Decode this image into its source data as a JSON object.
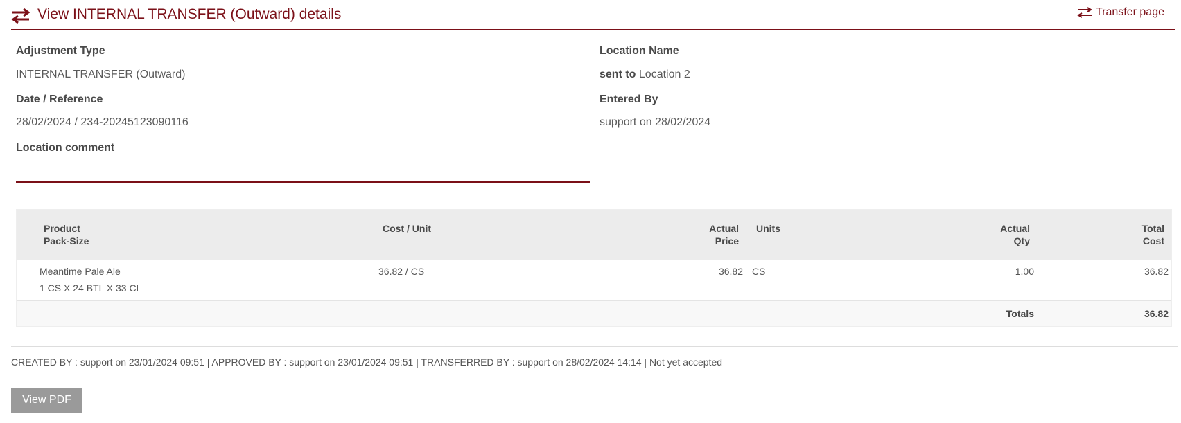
{
  "header": {
    "title": "View INTERNAL TRANSFER (Outward) details",
    "transfer_link": "Transfer page"
  },
  "details": {
    "adjustment_type_label": "Adjustment Type",
    "adjustment_type_value": "INTERNAL TRANSFER (Outward)",
    "date_reference_label": "Date / Reference",
    "date_reference_value": "28/02/2024 / 234-20245123090116",
    "location_comment_label": "Location comment",
    "location_name_label": "Location Name",
    "location_prefix": "sent to",
    "location_value": "Location 2",
    "entered_by_label": "Entered By",
    "entered_by_value": "support on 28/02/2024"
  },
  "table": {
    "headers": {
      "product": "Product",
      "pack_size": "Pack-Size",
      "cost_unit": "Cost / Unit",
      "actual_price_1": "Actual",
      "actual_price_2": "Price",
      "units": "Units",
      "actual_qty_1": "Actual",
      "actual_qty_2": "Qty",
      "total_cost_1": "Total",
      "total_cost_2": "Cost"
    },
    "rows": [
      {
        "product": "Meantime Pale Ale",
        "pack_size": "1 CS X 24 BTL X 33 CL",
        "cost_unit": "36.82 / CS",
        "actual_price": "36.82",
        "units": "CS",
        "actual_qty": "1.00",
        "total_cost": "36.82"
      }
    ],
    "totals_label": "Totals",
    "totals_value": "36.82"
  },
  "audit": "CREATED BY : support on 23/01/2024 09:51 | APPROVED BY : support on 23/01/2024 09:51 | TRANSFERRED BY : support on 28/02/2024 14:14 | Not yet accepted",
  "actions": {
    "view_pdf": "View PDF"
  },
  "colors": {
    "accent": "#7b1018",
    "button": "#9a9a9a",
    "table_header": "#ececec"
  }
}
